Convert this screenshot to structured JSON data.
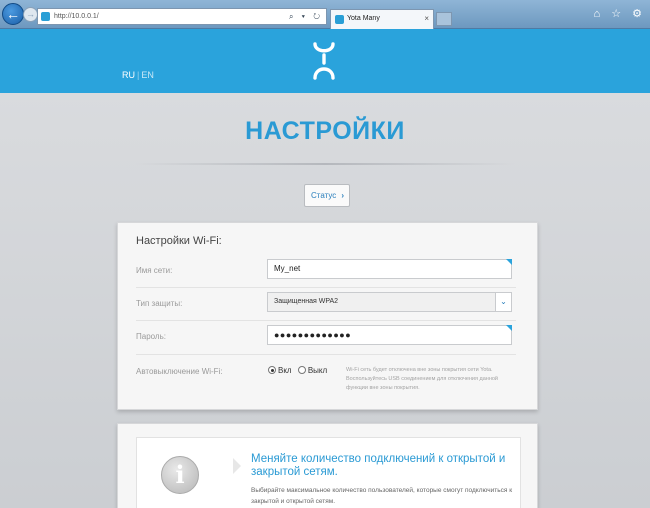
{
  "browser": {
    "url": "http://10.0.0.1/",
    "address_icons": "⌕ ▾ ↻",
    "tab_title": "Yota Many",
    "tab_close": "×",
    "right_icons": "⌂ ☆ ⚙"
  },
  "header": {
    "lang_ru": "RU",
    "lang_sep": "|",
    "lang_en": "EN",
    "brand_color": "#2aa3dc"
  },
  "page": {
    "title": "НАСТРОЙКИ",
    "status_button": "Статус",
    "status_arrow": "›"
  },
  "wifi": {
    "title": "Настройки Wi-Fi:",
    "network_name_label": "Имя сети:",
    "network_name_value": "My_net",
    "security_label": "Тип защиты:",
    "security_value": "Защищенная WPA2",
    "dropdown_glyph": "⌄",
    "password_label": "Пароль:",
    "password_value": "●●●●●●●●●●●●●",
    "autooff_label": "Автовыключение Wi-Fi:",
    "radio_on": "Вкл",
    "radio_off": "Выкл",
    "radio_selected": "on",
    "note": "Wi-Fi сеть будет отключена вне зоны покрытия сети Yota. Воспользуйтесь USB соединением для отключения данной функции вне зоны покрытия."
  },
  "info": {
    "icon_glyph": "i",
    "title": "Меняйте количество подключений к открытой и закрытой сетям.",
    "text": "Выбирайте максимальное количество пользователей, которые смогут подключиться к закрытой и открытой сетям."
  }
}
